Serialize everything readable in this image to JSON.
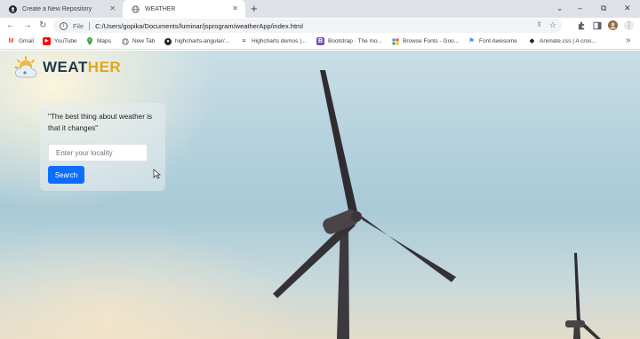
{
  "browser": {
    "tabs": [
      {
        "title": "Create a New Repository",
        "icon": "github-icon",
        "active": false
      },
      {
        "title": "WEATHER",
        "icon": "globe-icon",
        "active": true
      }
    ],
    "new_tab_label": "+",
    "window_controls": {
      "chevron": "⌄",
      "minimize": "–",
      "restore": "⧉",
      "close": "✕"
    },
    "toolbar": {
      "back": "←",
      "forward": "→",
      "reload": "↻",
      "address_scheme": "File",
      "address_url": "C:/Users/gopika/Documents/luminar/jsprogram/weatherApp/index.html",
      "menu": "⋮"
    },
    "bookmarks": [
      {
        "label": "Gmail",
        "icon": "gmail-icon",
        "glyph": "M",
        "color": "#ea4335"
      },
      {
        "label": "YouTube",
        "icon": "youtube-icon",
        "glyph": "▶",
        "color": "#ff0000"
      },
      {
        "label": "Maps",
        "icon": "maps-icon",
        "glyph": "⚲",
        "color": "#34a853"
      },
      {
        "label": "New Tab",
        "icon": "globe-icon",
        "glyph": "◍",
        "color": "#5f6368"
      },
      {
        "label": "highcharts-angular/...",
        "icon": "github-icon",
        "glyph": "●",
        "color": "#24292e"
      },
      {
        "label": "Highcharts demos |...",
        "icon": "highcharts-icon",
        "glyph": "≈",
        "color": "#434348"
      },
      {
        "label": "Bootstrap · The mo...",
        "icon": "bootstrap-icon",
        "glyph": "B",
        "color": "#7952b3"
      },
      {
        "label": "Browse Fonts - Goo...",
        "icon": "google-fonts-icon",
        "glyph": "▦",
        "color": "#4285f4"
      },
      {
        "label": "Font Awesome",
        "icon": "flag-icon",
        "glyph": "⚑",
        "color": "#4285f4"
      },
      {
        "label": "Animate.css | A cros...",
        "icon": "animate-icon",
        "glyph": "◆",
        "color": "#202124"
      }
    ]
  },
  "app": {
    "brand_part1": "WEAT",
    "brand_part2": "HER",
    "brand_colors": {
      "dark": "#1f3a4d",
      "accent": "#e5a51e"
    },
    "quote": "\"The best thing about weather is that it changes\"",
    "locality_placeholder": "Enter your locality",
    "search_label": "Search",
    "search_color": "#0d6efd"
  }
}
